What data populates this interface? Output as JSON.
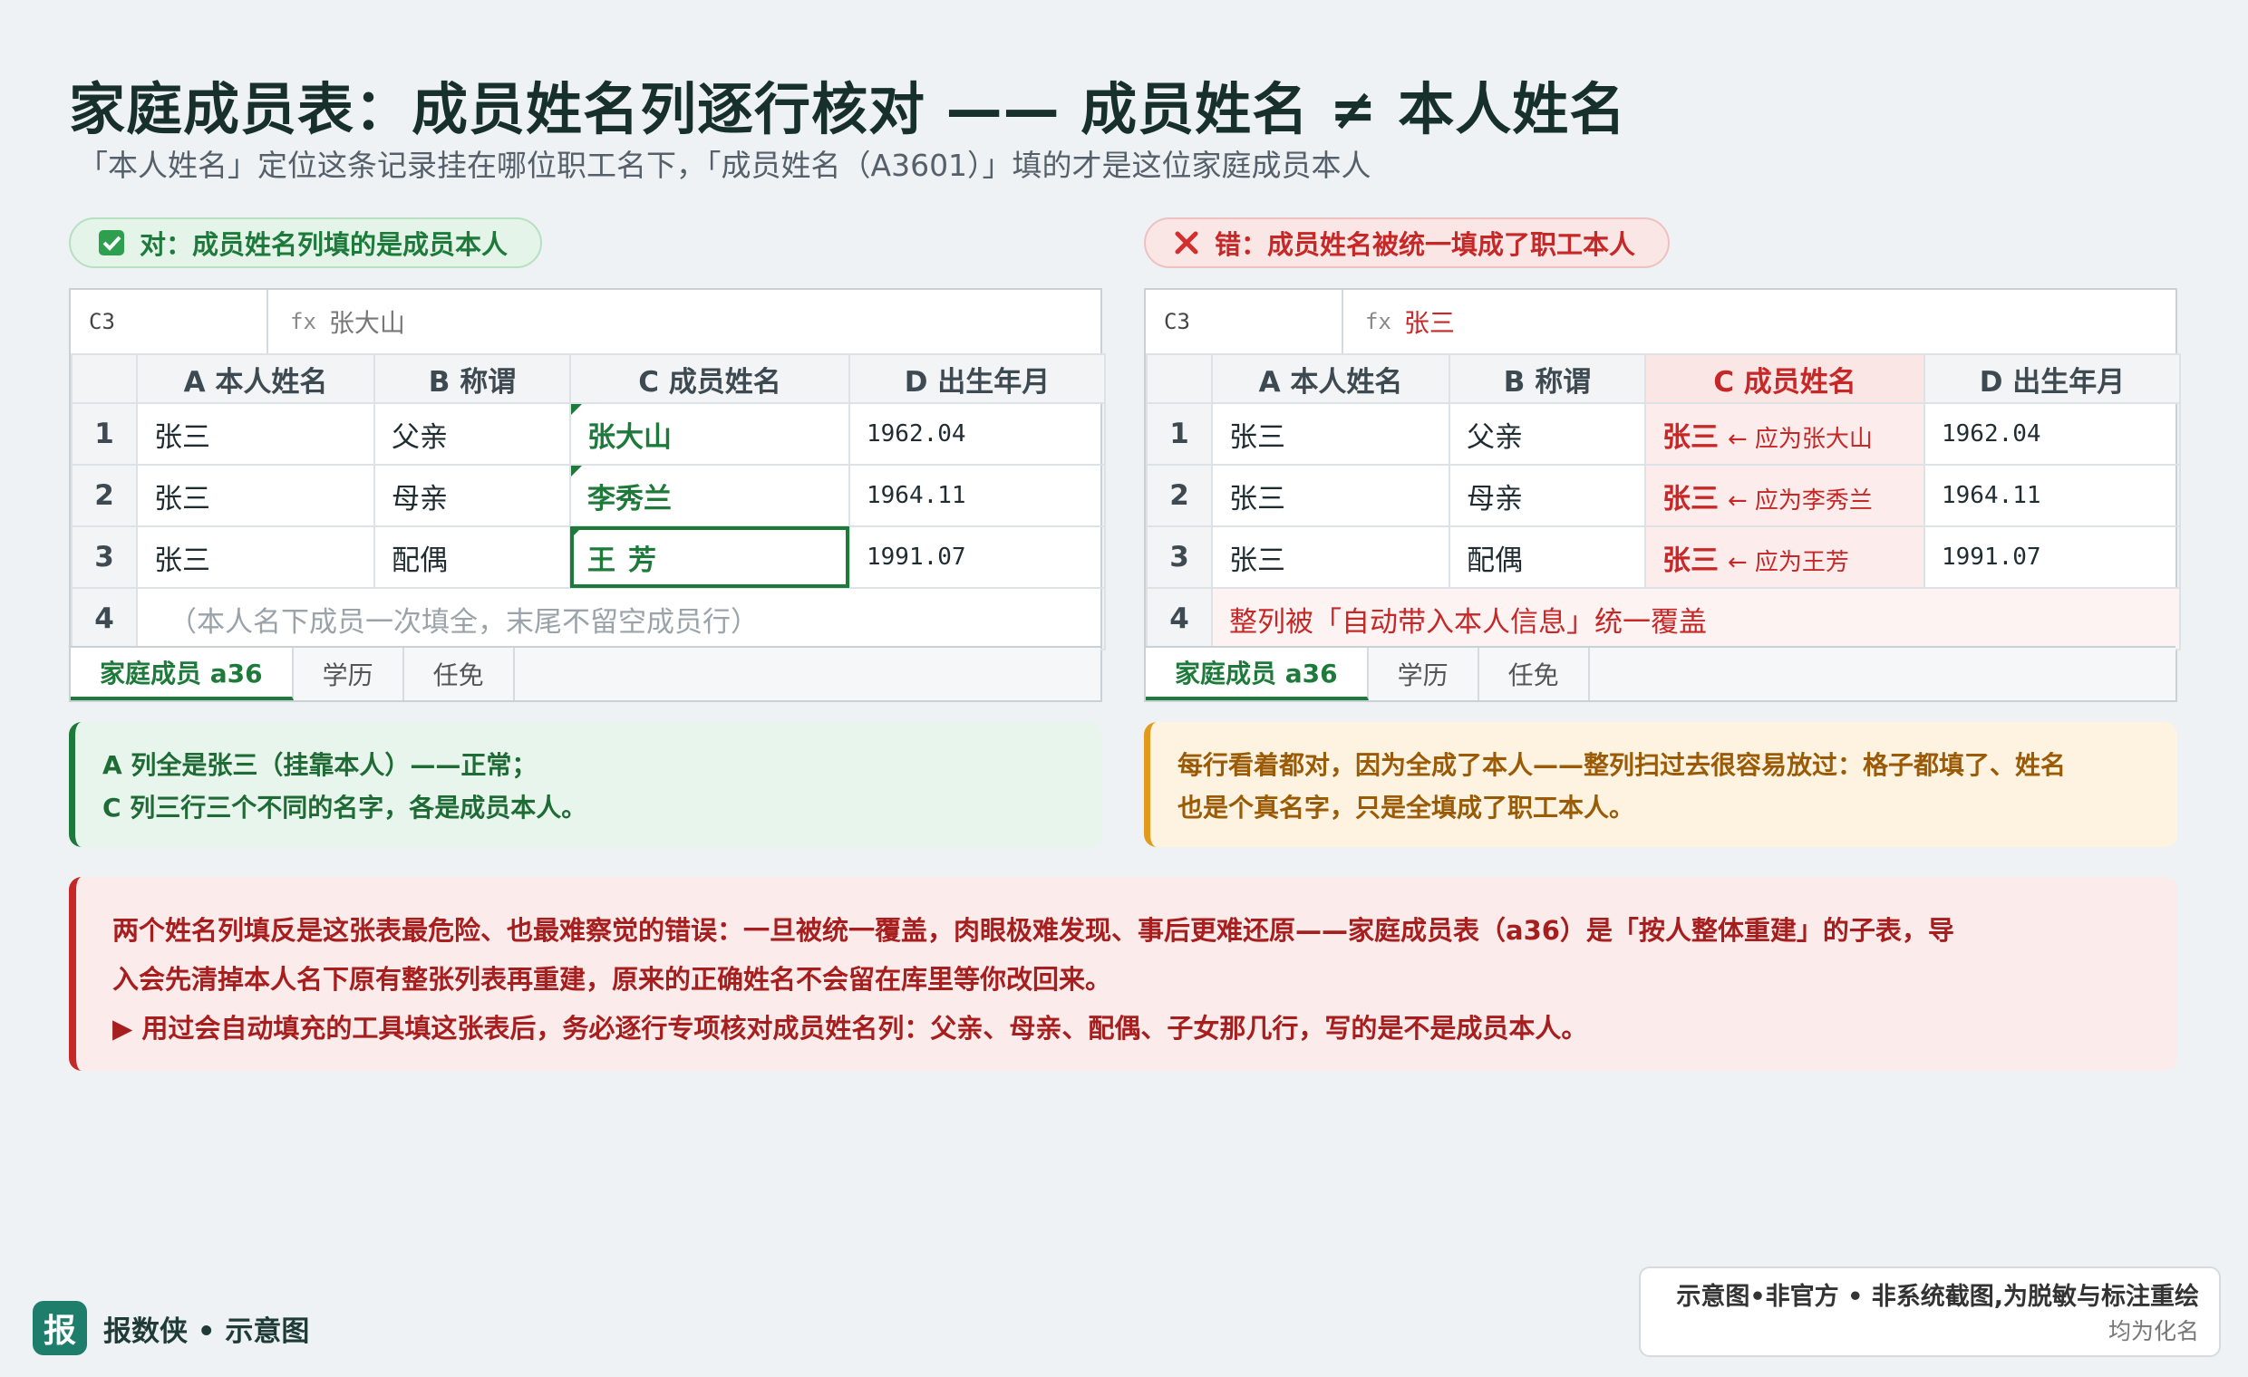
{
  "header": {
    "title": "家庭成员表：成员姓名列逐行核对 —— 成员姓名 ≠ 本人姓名",
    "subtitle": "「本人姓名」定位这条记录挂在哪位职工名下，「成员姓名（A3601）」填的才是这位家庭成员本人"
  },
  "left": {
    "pill": "对：成员姓名列填的是成员本人",
    "cell_ref": "C3",
    "fx": "fx",
    "formula": "张大山",
    "columns": [
      "",
      "A 本人姓名",
      "B 称谓",
      "C 成员姓名",
      "D 出生年月"
    ],
    "rows": [
      {
        "n": "1",
        "a": "张三",
        "b": "父亲",
        "c": "张大山",
        "d": "1962.04"
      },
      {
        "n": "2",
        "a": "张三",
        "b": "母亲",
        "c": "李秀兰",
        "d": "1964.11"
      },
      {
        "n": "3",
        "a": "张三",
        "b": "配偶",
        "c": "王芳",
        "d": "1991.07"
      }
    ],
    "row4_num": "4",
    "row4_note": "（本人名下成员一次填全，末尾不留空成员行）",
    "tabs": [
      "家庭成员 a36",
      "学历",
      "任免"
    ],
    "callout_line1": "A 列全是张三（挂靠本人）——正常；",
    "callout_line2": "C 列三行三个不同的名字，各是成员本人。"
  },
  "right": {
    "pill": "错：成员姓名被统一填成了职工本人",
    "cell_ref": "C3",
    "fx": "fx",
    "formula": "张三",
    "columns": [
      "",
      "A 本人姓名",
      "B 称谓",
      "C 成员姓名",
      "D 出生年月"
    ],
    "rows": [
      {
        "n": "1",
        "a": "张三",
        "b": "父亲",
        "c": "张三",
        "hint": "← 应为张大山",
        "d": "1962.04"
      },
      {
        "n": "2",
        "a": "张三",
        "b": "母亲",
        "c": "张三",
        "hint": "← 应为李秀兰",
        "d": "1964.11"
      },
      {
        "n": "3",
        "a": "张三",
        "b": "配偶",
        "c": "张三",
        "hint": "← 应为王芳",
        "d": "1991.07"
      }
    ],
    "row4_num": "4",
    "row4_note": "整列被「自动带入本人信息」统一覆盖",
    "tabs": [
      "家庭成员 a36",
      "学历",
      "任免"
    ],
    "callout_line1": "每行看着都对，因为全成了本人——整列扫过去很容易放过：格子都填了、姓名",
    "callout_line2": "也是个真名字，只是全填成了职工本人。"
  },
  "alert": {
    "line1": "两个姓名列填反是这张表最危险、也最难察觉的错误：一旦被统一覆盖，肉眼极难发现、事后更难还原——家庭成员表（a36）是「按人整体重建」的子表，导",
    "line2": "入会先清掉本人名下原有整张列表再重建，原来的正确姓名不会留在库里等你改回来。",
    "line3": "▶ 用过会自动填充的工具填这张表后，务必逐行专项核对成员姓名列：父亲、母亲、配偶、子女那几行，写的是不是成员本人。"
  },
  "footer": {
    "logo_char": "报",
    "brand": "报数侠 • 示意图",
    "disclaimer_line1": "示意图•非官方 • 非系统截图,为脱敏与标注重绘",
    "disclaimer_line2": "均为化名"
  },
  "colors": {
    "ok": "#1e7a3b",
    "error": "#c62828",
    "warn": "#e39a1c"
  }
}
